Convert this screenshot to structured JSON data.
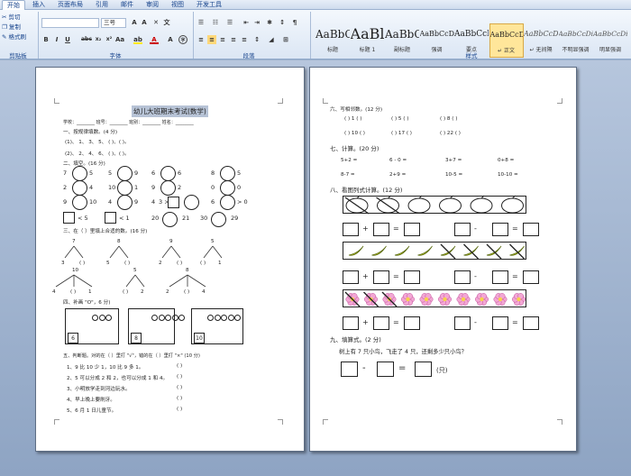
{
  "tabs": [
    "开始",
    "插入",
    "页面布局",
    "引用",
    "邮件",
    "审阅",
    "视图",
    "开发工具"
  ],
  "clipboard": {
    "cut": "剪切",
    "copy": "复制",
    "painter": "格式刷",
    "label": "剪贴板"
  },
  "font": {
    "name": "",
    "size": "三号",
    "label": "字体"
  },
  "paragraph": {
    "label": "段落"
  },
  "styles": {
    "label": "样式",
    "items": [
      {
        "sample": "AaBbC",
        "name": "标题"
      },
      {
        "sample": "AaBl",
        "name": "标题 1"
      },
      {
        "sample": "AaBbC",
        "name": "副标题"
      },
      {
        "sample": "AaBbCcDi",
        "name": "强调"
      },
      {
        "sample": "AaBbCcD",
        "name": "要点"
      },
      {
        "sample": "AaBbCcDc",
        "name": "↵ 正文"
      },
      {
        "sample": "AaBbCcDc",
        "name": "↵ 无间隔"
      },
      {
        "sample": "AaBbCcDi",
        "name": "不明显强调"
      },
      {
        "sample": "AaBbCcDi",
        "name": "明显强调"
      }
    ]
  },
  "left": {
    "title": "幼儿大班期末考试(数学)",
    "info": "学校：________ 班号：________ 班别：________ 姓名：________",
    "s1": "一、按规律填数。(4 分)",
    "s1a": "(1)、 1、 3、 5、 (  )、(  )。",
    "s1b": "(2)、 2、 4、 6、 (  )、(  )。",
    "s2": "二、填空。(16 分)",
    "cmp": [
      [
        "7",
        "5"
      ],
      [
        "5",
        "9"
      ],
      [
        "6",
        "6"
      ],
      [
        "8",
        "5"
      ],
      [
        "2",
        "4"
      ],
      [
        "10",
        "1"
      ],
      [
        "9",
        "2"
      ],
      [
        "0",
        "0"
      ],
      [
        "9",
        "10"
      ],
      [
        "4",
        "9"
      ],
      [
        "4",
        "3 >"
      ],
      [
        "6",
        "> 0"
      ]
    ],
    "row4": [
      "< 5",
      "< 1",
      "20",
      "21",
      "30",
      "29"
    ],
    "s3": "三、在（ ）里填上合适的数。(16 分)",
    "split_top": [
      "7",
      "8",
      "9",
      "5"
    ],
    "split_bottom": [
      [
        "3",
        "(  )"
      ],
      [
        "5",
        "(  )"
      ],
      [
        "2",
        "(  )"
      ],
      [
        "(  )",
        "1"
      ]
    ],
    "split_top2": [
      "10",
      "5",
      "8"
    ],
    "split_bottom2": [
      [
        "4",
        "(  )",
        "1"
      ],
      [
        "(  )",
        "2"
      ],
      [
        "2",
        "(  )",
        "4"
      ]
    ],
    "s4": "四、补画 \"O\"，6 分)",
    "boxes": [
      "6",
      "8",
      "10"
    ],
    "s5": "五、判断题。对的在（ ）里打 \"√\"，错的在（ ）里打 \"×\" (10 分)",
    "judge": [
      "1、9 比 10 少 1，10 比 9 多 1。",
      "2、5 可以分成 2 和 2，也可以分成 1 和 4。",
      "3、小明放学走到河边玩水。",
      "4、早上晚上要刷牙。",
      "5、6 月 1 日儿童节。"
    ],
    "paren": "(  )"
  },
  "right": {
    "s6": "六、写相邻数。(12 分)",
    "neigh1": [
      "(  ) 1 (  )",
      "(  ) 5 (  )",
      "(  ) 8 (  )"
    ],
    "neigh2": [
      "(  ) 10 (  )",
      "(  ) 17 (  )",
      "(  ) 22 (  )"
    ],
    "s7": "七、计算。(20 分)",
    "calc1": [
      "5+2 =",
      "6 - 0 =",
      "3+7 =",
      "0+8 ="
    ],
    "calc2": [
      "8-7 =",
      "2+9 =",
      "10-5 =",
      "10-10 ="
    ],
    "s8": "八、看图列式计算。(12 分)",
    "s9": "九、填算式。(2 分)",
    "question": "树上有 7 只小鸟，飞走了 4 只，还剩多少只小鸟？",
    "unit": "(只)",
    "ops": [
      "+",
      "=",
      "-",
      "="
    ]
  },
  "colors": {
    "bg": "#9fb3cc",
    "ribbon": "#dbe6f4",
    "accent": "#15428b",
    "title_hl": "#b7c3d6"
  }
}
